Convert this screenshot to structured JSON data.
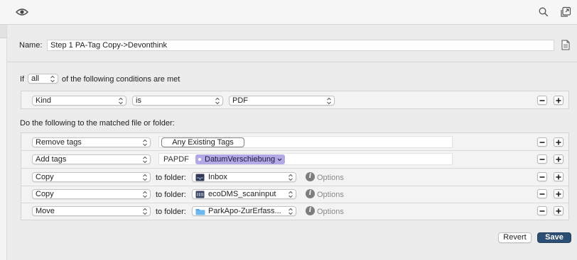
{
  "toolbar": {
    "left_icon": "eye-icon",
    "right_icons": [
      "search-icon",
      "open-external-icon"
    ]
  },
  "name": {
    "label": "Name:",
    "value": "Step 1 PA-Tag Copy->Devonthink",
    "doc_icon": "document-icon"
  },
  "conditions": {
    "prefix": "If",
    "quantifier": "all",
    "suffix": "of the following conditions are met",
    "rows": [
      {
        "attribute": "Kind",
        "operator": "is",
        "value": "PDF"
      }
    ]
  },
  "actions": {
    "heading": "Do the following to the matched file or folder:",
    "rows": [
      {
        "action": "Remove tags",
        "tag": "Any Existing Tags"
      },
      {
        "action": "Add tags",
        "prefix_text": "PAPDF",
        "tag": "DatumVerschiebung"
      },
      {
        "action": "Copy",
        "to_label": "to folder:",
        "folder": "Inbox",
        "options": "Options"
      },
      {
        "action": "Copy",
        "to_label": "to folder:",
        "folder": "ecoDMS_scaninput",
        "options": "Options"
      },
      {
        "action": "Move",
        "to_label": "to folder:",
        "folder": "ParkApo-ZurErfass...",
        "options": "Options"
      }
    ]
  },
  "buttons": {
    "revert": "Revert",
    "save": "Save"
  },
  "colors": {
    "tag_purple": "#b3a9e6",
    "save_blue": "#2d4f73",
    "folder_blue": "#4fa3e0"
  }
}
